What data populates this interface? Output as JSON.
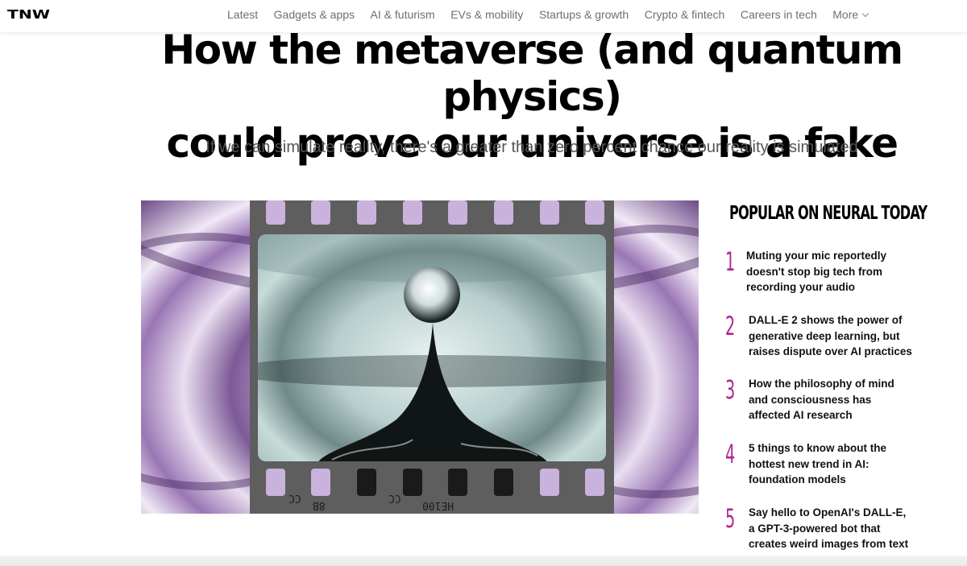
{
  "site": {
    "logo": "TNW"
  },
  "nav": {
    "items": [
      "Latest",
      "Gadgets & apps",
      "AI & futurism",
      "EVs & mobility",
      "Startups & growth",
      "Crypto & fintech",
      "Careers in tech"
    ],
    "more_label": "More"
  },
  "article": {
    "title_line1": "How the metaverse (and quantum physics)",
    "title_line2": "could prove our universe is a fake",
    "subtitle": "If we can simulate reality, there's a greater than zero percent chance our reality is simulated",
    "image": {
      "description_icon": "water-drop-film-image",
      "film_codes": [
        "CC",
        "8B",
        "CC",
        "HE100"
      ]
    }
  },
  "sidebar": {
    "title": "POPULAR ON NEURAL TODAY",
    "accent_color": "#b0278f",
    "items": [
      {
        "num": "1",
        "text": "Muting your mic reportedly doesn't stop big tech from recording your audio"
      },
      {
        "num": "2",
        "text": "DALL-E 2 shows the power of generative deep learning, but raises dispute over AI practices"
      },
      {
        "num": "3",
        "text": "How the philosophy of mind and consciousness has affected AI research"
      },
      {
        "num": "4",
        "text": "5 things to know about the hottest new trend in AI: foundation models"
      },
      {
        "num": "5",
        "text": "Say hello to OpenAI's DALL-E, a GPT-3-powered bot that creates weird images from text"
      }
    ]
  }
}
